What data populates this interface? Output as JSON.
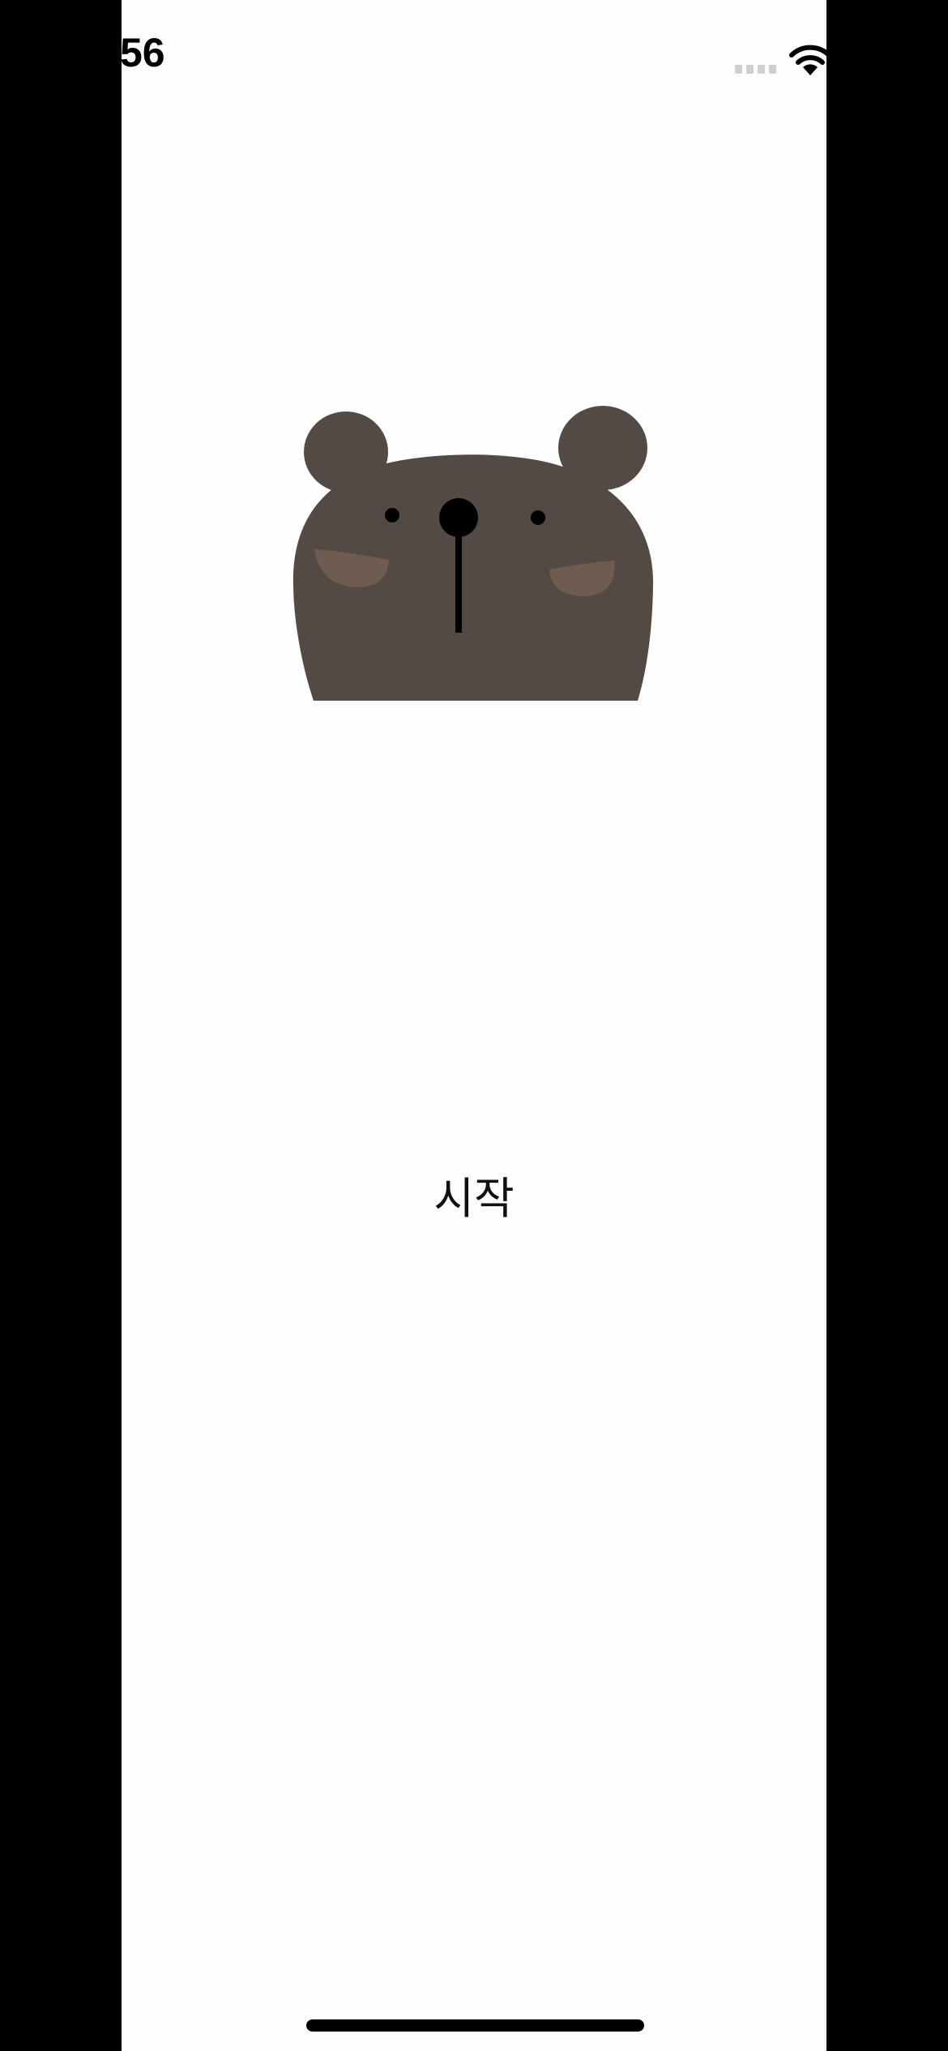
{
  "status_bar": {
    "time": "56",
    "signal_icon": "cellular-signal-icon",
    "wifi_icon": "wifi-icon"
  },
  "illustration": {
    "icon": "bear-face-illustration",
    "colors": {
      "fur": "#544a44",
      "cheeks": "#6e5c50",
      "features": "#000000"
    }
  },
  "main": {
    "start_label": "시작"
  },
  "colors": {
    "background": "#fdfdfd",
    "letterbox": "#000000",
    "text": "#111111"
  }
}
